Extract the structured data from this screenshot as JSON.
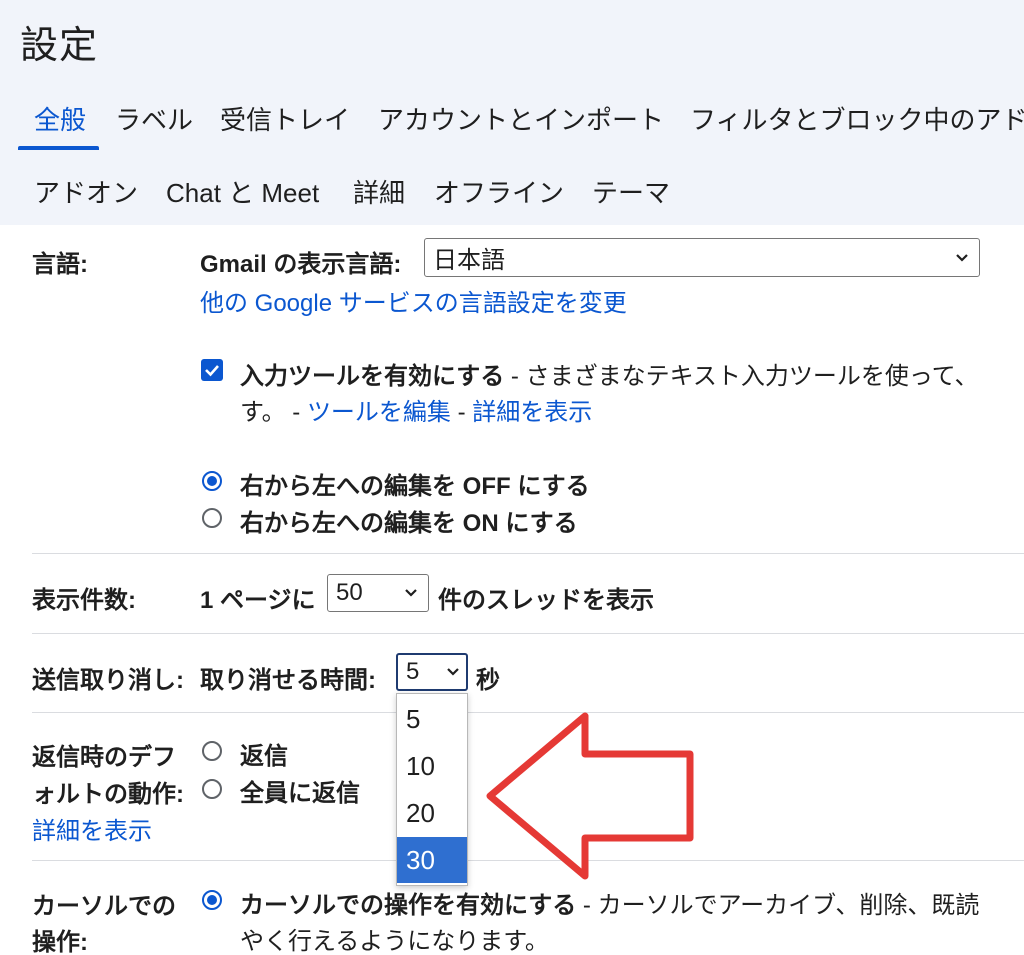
{
  "page_title": "設定",
  "tabs": [
    {
      "label": "全般",
      "active": true
    },
    {
      "label": "ラベル"
    },
    {
      "label": "受信トレイ"
    },
    {
      "label": "アカウントとインポート"
    },
    {
      "label": "フィルタとブロック中のアド"
    },
    {
      "label": "アドオン"
    },
    {
      "label": "Chat と Meet"
    },
    {
      "label": "詳細"
    },
    {
      "label": "オフライン"
    },
    {
      "label": "テーマ"
    }
  ],
  "language": {
    "label": "言語:",
    "display_label": "Gmail の表示言語:",
    "display_value": "日本語",
    "other_link": "他の Google サービスの言語設定を変更",
    "input_tools": {
      "checked": true,
      "title": "入力ツールを有効にする",
      "desc_prefix": " - さまざまなテキスト入力ツールを使って、",
      "desc_line2_prefix": "す。 - ",
      "edit_link": "ツールを編集",
      "sep": " - ",
      "details_link": "詳細を表示"
    },
    "rtl_off": "右から左への編集を OFF にする",
    "rtl_on": "右から左への編集を ON にする",
    "rtl_selected": "off"
  },
  "page_size": {
    "label": "表示件数:",
    "prefix": "1 ページに",
    "value": "50",
    "suffix": "件のスレッドを表示"
  },
  "undo_send": {
    "label": "送信取り消し:",
    "time_label": "取り消せる時間:",
    "value": "5",
    "unit": "秒",
    "options": [
      "5",
      "10",
      "20",
      "30"
    ],
    "highlighted_option": "30"
  },
  "reply_default": {
    "label_line1": "返信時のデフ",
    "label_line2": "ォルトの動作:",
    "reply": "返信",
    "reply_all": "全員に返信",
    "details_link": "詳細を表示"
  },
  "cursor_actions": {
    "label_line1": "カーソルでの",
    "label_line2": "操作:",
    "option_title": "カーソルでの操作を有効にする",
    "desc_prefix": " - カーソルでアーカイブ、削除、既読",
    "desc_line2": "やく行えるようになります。"
  },
  "colors": {
    "accent": "#0b57d0",
    "header_bg": "#f1f4fa",
    "option_highlight": "#2f6fd0",
    "arrow": "#e53935"
  }
}
